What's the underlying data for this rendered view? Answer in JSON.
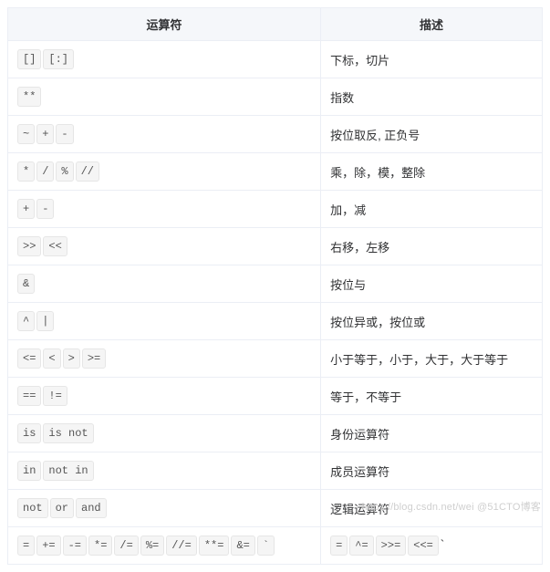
{
  "headers": {
    "operator": "运算符",
    "description": "描述"
  },
  "rows": [
    {
      "ops": [
        "[]",
        "[:]"
      ],
      "desc": "下标，切片"
    },
    {
      "ops": [
        "**"
      ],
      "desc": "指数"
    },
    {
      "ops": [
        "~",
        "+",
        "-"
      ],
      "desc": "按位取反, 正负号"
    },
    {
      "ops": [
        "*",
        "/",
        "%",
        "//"
      ],
      "desc": "乘，除，模，整除"
    },
    {
      "ops": [
        "+",
        "-"
      ],
      "desc": "加，减"
    },
    {
      "ops": [
        ">>",
        "<<"
      ],
      "desc": "右移，左移"
    },
    {
      "ops": [
        "&"
      ],
      "desc": "按位与"
    },
    {
      "ops": [
        "^",
        "|"
      ],
      "desc": "按位异或，按位或"
    },
    {
      "ops": [
        "<=",
        "<",
        ">",
        ">="
      ],
      "desc": "小于等于，小于，大于，大于等于"
    },
    {
      "ops": [
        "==",
        "!="
      ],
      "desc": "等于，不等于"
    },
    {
      "ops": [
        "is",
        "is not"
      ],
      "desc": "身份运算符"
    },
    {
      "ops": [
        "in",
        "not in"
      ],
      "desc": "成员运算符"
    },
    {
      "ops": [
        "not",
        "or",
        "and"
      ],
      "desc": "逻辑运算符"
    },
    {
      "ops": [
        "=",
        "+=",
        "-=",
        "*=",
        "/=",
        "%=",
        "//=",
        "**=",
        "&=",
        "`"
      ],
      "desc_ops": [
        "=",
        "^=",
        ">>=",
        "<<="
      ],
      "desc_trail": "`"
    }
  ],
  "watermark": "https://blog.csdn.net/wei @51CTO博客"
}
